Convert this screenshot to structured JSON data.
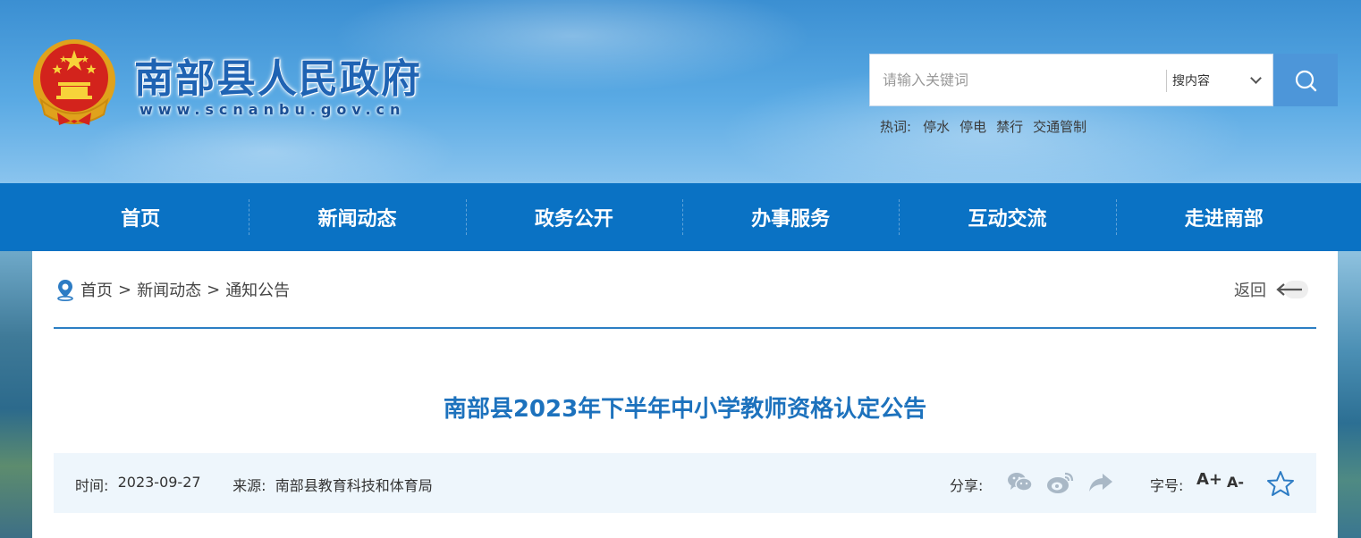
{
  "header": {
    "site_title": "南部县人民政府",
    "site_url": "www.scnanbu.gov.cn",
    "search": {
      "placeholder": "请输入关键词",
      "scope_selected": "搜内容",
      "button_icon": "search-icon"
    },
    "hotwords": {
      "label": "热词:",
      "items": [
        "停水",
        "停电",
        "禁行",
        "交通管制"
      ]
    }
  },
  "nav": {
    "items": [
      "首页",
      "新闻动态",
      "政务公开",
      "办事服务",
      "互动交流",
      "走进南部"
    ],
    "active_index": 1
  },
  "breadcrumb": {
    "items": [
      "首页",
      "新闻动态",
      "通知公告"
    ],
    "separator": ">"
  },
  "back_label": "返回",
  "article": {
    "title": "南部县2023年下半年中小学教师资格认定公告",
    "time_label": "时间:",
    "time_value": "2023-09-27",
    "source_label": "来源:",
    "source_value": "南部县教育科技和体育局",
    "share_label": "分享:",
    "font_label": "字号:",
    "font_increase": "A+",
    "font_decrease": "A-"
  },
  "colors": {
    "nav_bg": "#0a72c4",
    "title_color": "#1d72bd",
    "search_button": "#4d96d9",
    "meta_bg": "#eef6fc"
  }
}
